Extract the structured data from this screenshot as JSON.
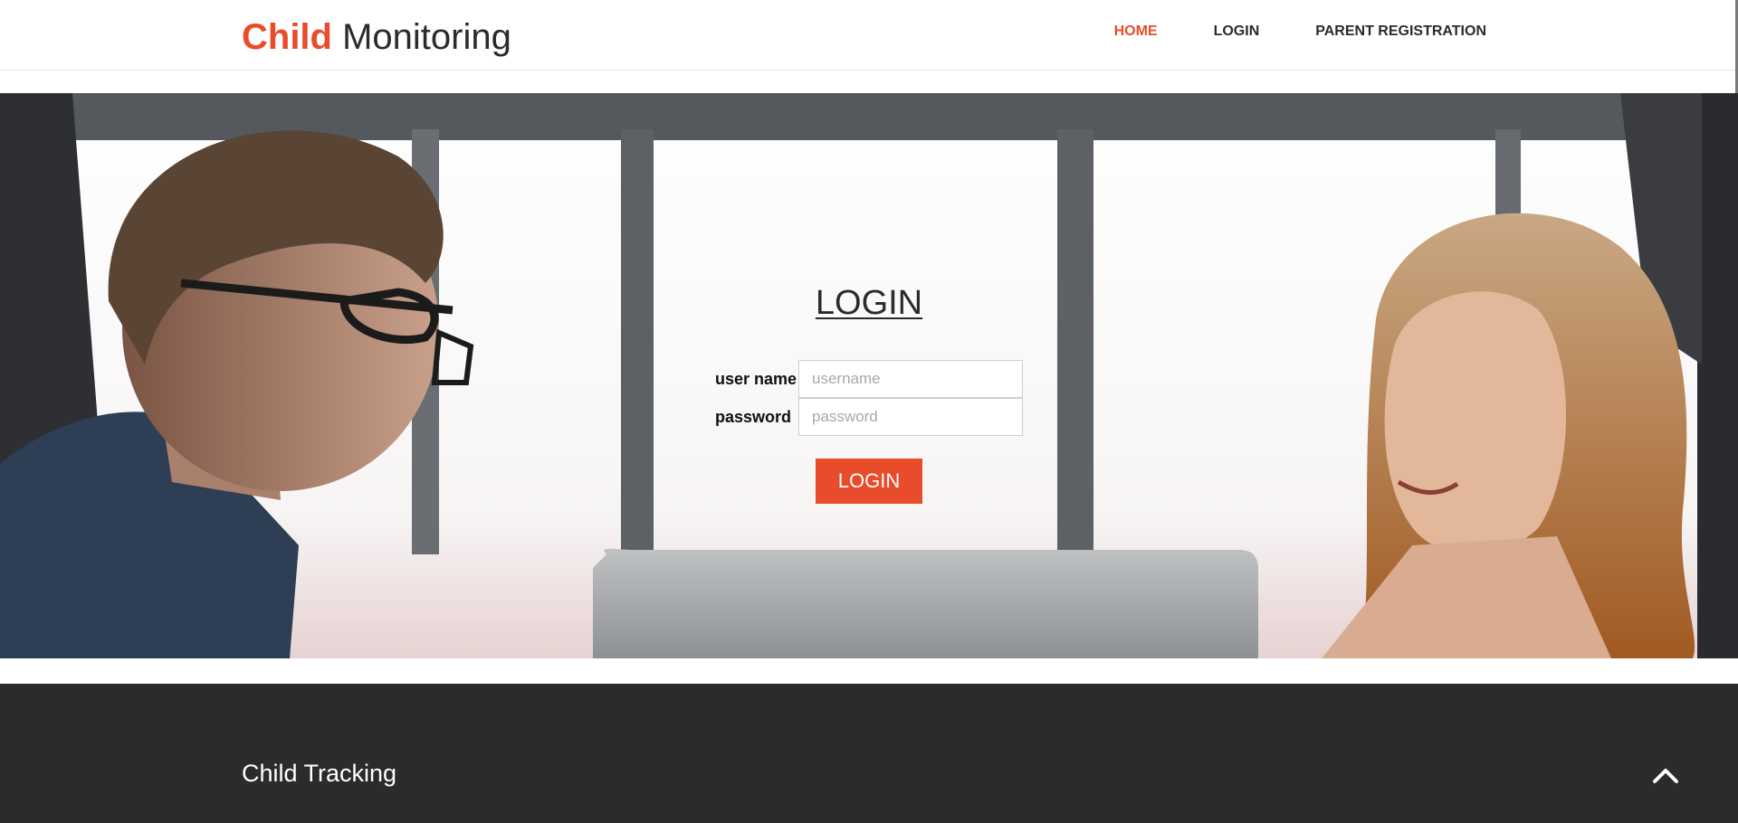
{
  "brand": {
    "accent": "Child",
    "rest": " Monitoring"
  },
  "nav": {
    "items": [
      {
        "label": "HOME",
        "active": true
      },
      {
        "label": "LOGIN",
        "active": false
      },
      {
        "label": "PARENT REGISTRATION",
        "active": false
      }
    ]
  },
  "login": {
    "title": "LOGIN",
    "username_label": "user name",
    "username_placeholder": "username",
    "username_value": "",
    "password_label": "password",
    "password_placeholder": "password",
    "password_value": "",
    "button_label": "LOGIN"
  },
  "footer": {
    "title": "Child Tracking",
    "back_to_top_icon": "chevron-up-icon"
  },
  "colors": {
    "accent": "#e84c2b",
    "text_dark": "#2b2b2b",
    "footer_bg": "#2b2b2b"
  }
}
